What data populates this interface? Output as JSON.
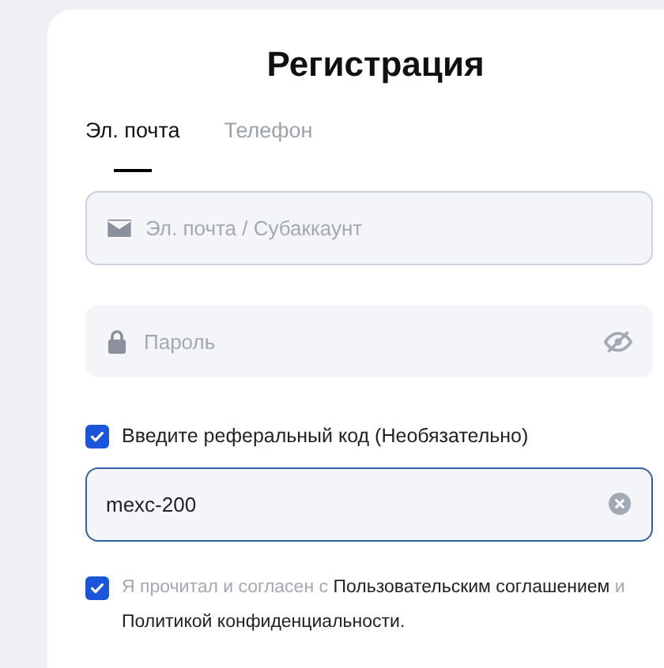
{
  "title": "Регистрация",
  "tabs": [
    {
      "label": "Эл. почта",
      "selected": true
    },
    {
      "label": "Телефон",
      "selected": false
    }
  ],
  "email_field": {
    "placeholder": "Эл. почта / Субаккаунт"
  },
  "password_field": {
    "placeholder": "Пароль"
  },
  "referral": {
    "checked": true,
    "label": "Введите реферальный код (Необязательно)",
    "value": "mexc-200"
  },
  "agreement": {
    "checked": true,
    "text": "Я прочитал и согласен с",
    "link_1": "Пользовательским соглашением",
    "connector": "и",
    "link_2": "Политикой конфиденциальности",
    "end": "."
  }
}
